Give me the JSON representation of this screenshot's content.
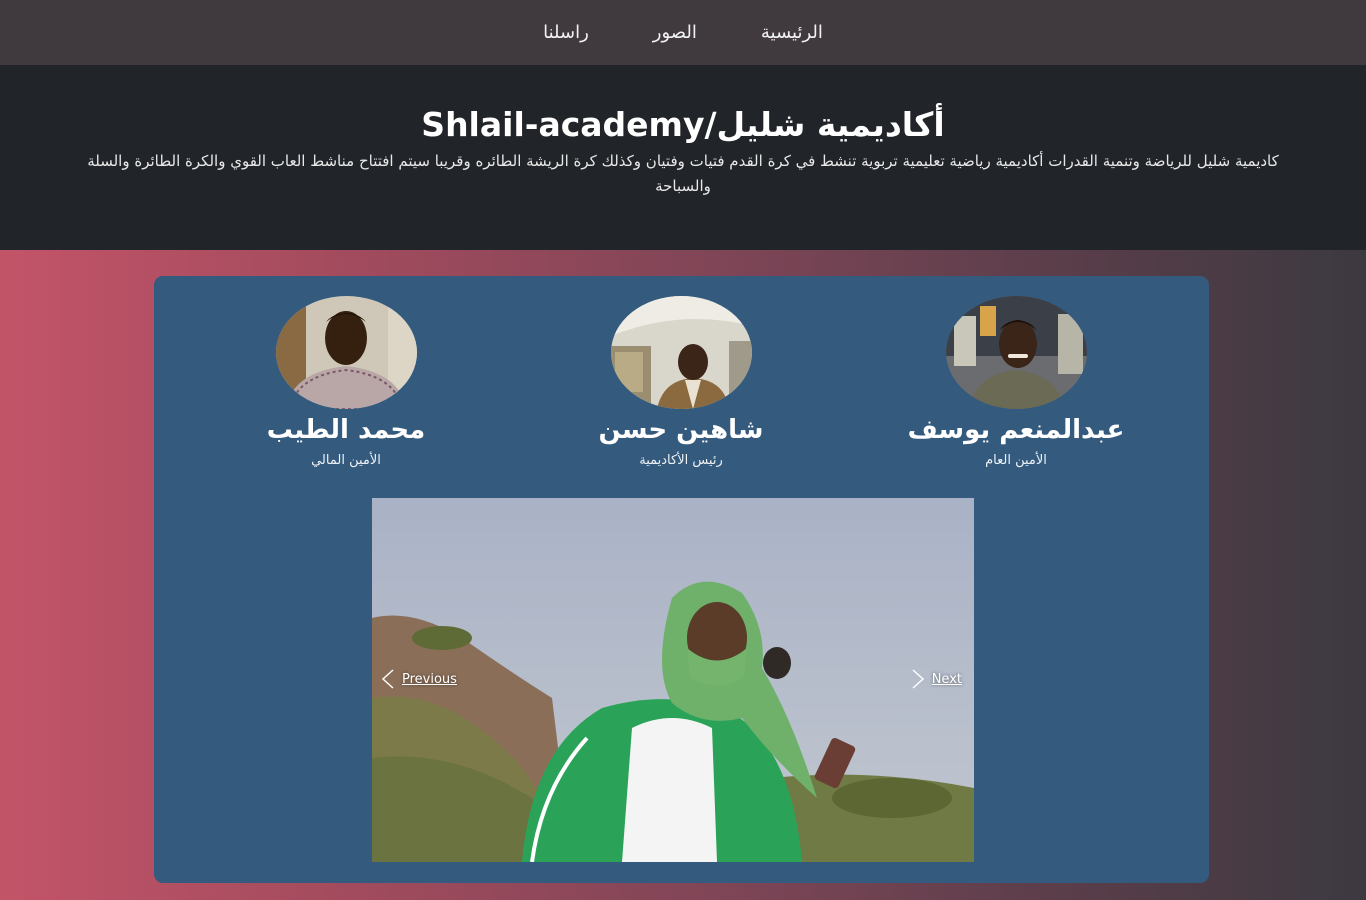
{
  "nav": {
    "home": "الرئيسية",
    "photos": "الصور",
    "contact": "راسلنا"
  },
  "header": {
    "title": "Shlail-academy/أكاديمية شليل",
    "description": "كاديمية شليل للرياضة وتنمية القدرات أكاديمية رياضية تعليمية تربوية تنشط في كرة القدم فتيات وفتيان وكذلك كرة الريشة الطائره وقريبا سيتم افتتاح مناشط العاب القوي والكرة الطائرة والسلة والسباحة"
  },
  "members": [
    {
      "name": "عبدالمنعم يوسف",
      "role": "الأمين العام"
    },
    {
      "name": "شاهين حسن",
      "role": "رئيس الأكاديمية"
    },
    {
      "name": "محمد الطيب",
      "role": "الأمين المالي"
    }
  ],
  "carousel": {
    "prev_label": "Previous",
    "next_label": "Next"
  }
}
